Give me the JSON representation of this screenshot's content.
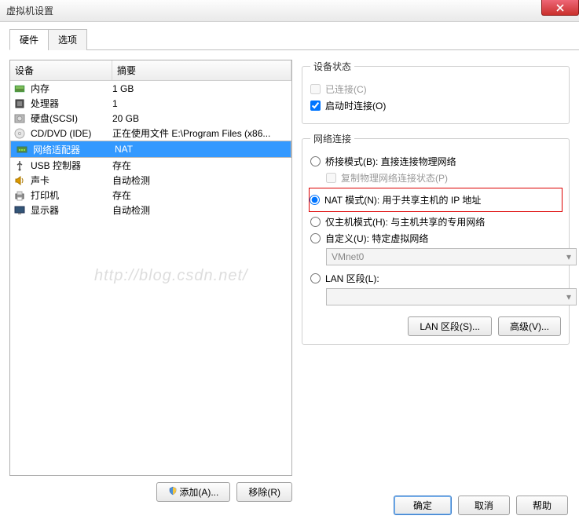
{
  "window": {
    "title": "虚拟机设置"
  },
  "tabs": {
    "hardware": "硬件",
    "options": "选项"
  },
  "list": {
    "headers": {
      "device": "设备",
      "summary": "摘要"
    },
    "rows": [
      {
        "name": "内存",
        "summary": "1 GB",
        "icon": "memory"
      },
      {
        "name": "处理器",
        "summary": "1",
        "icon": "cpu"
      },
      {
        "name": "硬盘(SCSI)",
        "summary": "20 GB",
        "icon": "disk"
      },
      {
        "name": "CD/DVD (IDE)",
        "summary": "正在使用文件 E:\\Program Files (x86...",
        "icon": "cd"
      },
      {
        "name": "网络适配器",
        "summary": "NAT",
        "icon": "net",
        "selected": true
      },
      {
        "name": "USB 控制器",
        "summary": "存在",
        "icon": "usb"
      },
      {
        "name": "声卡",
        "summary": "自动检测",
        "icon": "sound"
      },
      {
        "name": "打印机",
        "summary": "存在",
        "icon": "printer"
      },
      {
        "name": "显示器",
        "summary": "自动检测",
        "icon": "display"
      }
    ]
  },
  "leftbtns": {
    "add": "添加(A)...",
    "remove": "移除(R)"
  },
  "status": {
    "legend": "设备状态",
    "connected": "已连接(C)",
    "connect_on": "启动时连接(O)"
  },
  "net": {
    "legend": "网络连接",
    "bridged": "桥接模式(B): 直接连接物理网络",
    "replicate": "复制物理网络连接状态(P)",
    "nat": "NAT 模式(N): 用于共享主机的 IP 地址",
    "hostonly": "仅主机模式(H): 与主机共享的专用网络",
    "custom": "自定义(U): 特定虚拟网络",
    "vmnet": "VMnet0",
    "lanseg": "LAN 区段(L):",
    "lanseg_btn": "LAN 区段(S)...",
    "adv_btn": "高级(V)..."
  },
  "dlg": {
    "ok": "确定",
    "cancel": "取消",
    "help": "帮助"
  },
  "watermark": "http://blog.csdn.net/"
}
